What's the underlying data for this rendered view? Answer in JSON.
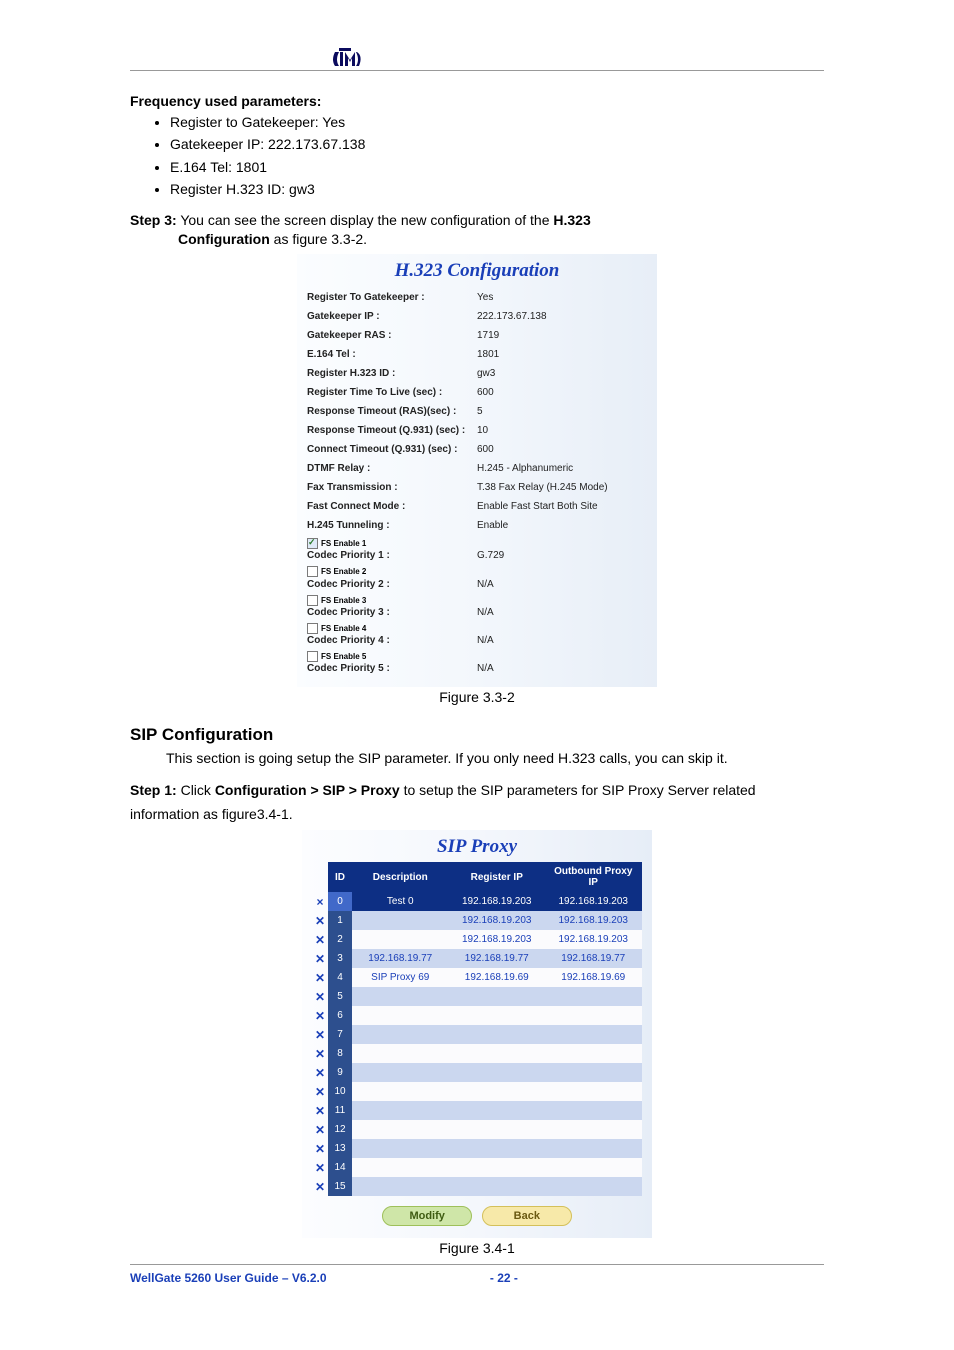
{
  "header": {
    "logo_text": "tm"
  },
  "freq": {
    "heading": "Frequency used parameters:",
    "items": [
      "Register to Gatekeeper: Yes",
      "Gatekeeper IP: 222.173.67.138",
      "E.164 Tel: 1801",
      "Register H.323 ID: gw3"
    ]
  },
  "step3": {
    "prefix": "Step 3:",
    "text1": " You can see the screen display the new configuration of the ",
    "bold1": "H.323",
    "text2": "Configuration",
    "text3": " as figure 3.3-2."
  },
  "h323": {
    "title": "H.323 Configuration",
    "rows": [
      {
        "label": "Register To Gatekeeper :",
        "value": "Yes"
      },
      {
        "label": "Gatekeeper IP :",
        "value": "222.173.67.138"
      },
      {
        "label": "Gatekeeper RAS :",
        "value": "1719"
      },
      {
        "label": "E.164 Tel :",
        "value": "1801"
      },
      {
        "label": "Register H.323 ID :",
        "value": "gw3"
      },
      {
        "label": "Register Time To Live (sec) :",
        "value": "600"
      },
      {
        "label": "Response Timeout (RAS)(sec) :",
        "value": "5"
      },
      {
        "label": "Response Timeout (Q.931) (sec) :",
        "value": "10"
      },
      {
        "label": "Connect Timeout (Q.931) (sec) :",
        "value": "600"
      },
      {
        "label": "DTMF Relay :",
        "value": "H.245 - Alphanumeric"
      },
      {
        "label": "Fax Transmission :",
        "value": "T.38 Fax Relay (H.245 Mode)"
      },
      {
        "label": "Fast Connect Mode :",
        "value": "Enable Fast Start Both Site"
      },
      {
        "label": "H.245 Tunneling :",
        "value": "Enable"
      }
    ],
    "codecs": [
      {
        "fs": "FS Enable 1",
        "label": "Codec Priority 1 :",
        "value": "G.729",
        "checked": true
      },
      {
        "fs": "FS Enable 2",
        "label": "Codec Priority 2 :",
        "value": "N/A",
        "checked": false
      },
      {
        "fs": "FS Enable 3",
        "label": "Codec Priority 3 :",
        "value": "N/A",
        "checked": false
      },
      {
        "fs": "FS Enable 4",
        "label": "Codec Priority 4 :",
        "value": "N/A",
        "checked": false
      },
      {
        "fs": "FS Enable 5",
        "label": "Codec Priority 5 :",
        "value": "N/A",
        "checked": false
      }
    ],
    "caption": "Figure 3.3-2"
  },
  "sipconf": {
    "heading": "SIP Configuration",
    "intro": "This section is going setup the SIP parameter. If you only need H.323 calls, you can skip it."
  },
  "step1": {
    "prefix": "Step 1:",
    "text1": " Click ",
    "bold1": "Configuration > SIP > Proxy",
    "text2": " to setup the SIP parameters for SIP Proxy Server related information as figure3.4-1."
  },
  "sipproxy": {
    "title": "SIP Proxy",
    "headers": {
      "id": "ID",
      "desc": "Description",
      "reg": "Register IP",
      "out": "Outbound Proxy IP"
    },
    "rows": [
      {
        "sel": true,
        "x": "×",
        "xc": "red",
        "id": "0",
        "desc": "Test 0",
        "reg": "192.168.19.203",
        "out": "192.168.19.203"
      },
      {
        "x": "✕",
        "xc": "muted",
        "id": "1",
        "desc": "",
        "reg": "192.168.19.203",
        "out": "192.168.19.203"
      },
      {
        "x": "✕",
        "xc": "muted",
        "id": "2",
        "desc": "",
        "reg": "192.168.19.203",
        "out": "192.168.19.203"
      },
      {
        "x": "✕",
        "xc": "muted",
        "id": "3",
        "desc": "192.168.19.77",
        "reg": "192.168.19.77",
        "out": "192.168.19.77"
      },
      {
        "x": "✕",
        "xc": "muted",
        "id": "4",
        "desc": "SIP Proxy 69",
        "reg": "192.168.19.69",
        "out": "192.168.19.69"
      },
      {
        "x": "✕",
        "xc": "muted",
        "id": "5",
        "desc": "",
        "reg": "",
        "out": ""
      },
      {
        "x": "✕",
        "xc": "muted",
        "id": "6",
        "desc": "",
        "reg": "",
        "out": ""
      },
      {
        "x": "✕",
        "xc": "muted",
        "id": "7",
        "desc": "",
        "reg": "",
        "out": ""
      },
      {
        "x": "✕",
        "xc": "muted",
        "id": "8",
        "desc": "",
        "reg": "",
        "out": ""
      },
      {
        "x": "✕",
        "xc": "muted",
        "id": "9",
        "desc": "",
        "reg": "",
        "out": ""
      },
      {
        "x": "✕",
        "xc": "muted",
        "id": "10",
        "desc": "",
        "reg": "",
        "out": ""
      },
      {
        "x": "✕",
        "xc": "muted",
        "id": "11",
        "desc": "",
        "reg": "",
        "out": ""
      },
      {
        "x": "✕",
        "xc": "muted",
        "id": "12",
        "desc": "",
        "reg": "",
        "out": ""
      },
      {
        "x": "✕",
        "xc": "muted",
        "id": "13",
        "desc": "",
        "reg": "",
        "out": ""
      },
      {
        "x": "✕",
        "xc": "muted",
        "id": "14",
        "desc": "",
        "reg": "",
        "out": ""
      },
      {
        "x": "✕",
        "xc": "muted",
        "id": "15",
        "desc": "",
        "reg": "",
        "out": ""
      }
    ],
    "modify": "Modify",
    "back": "Back",
    "caption": "Figure 3.4-1"
  },
  "footer": {
    "left": "WellGate 5260 User Guide – V6.2.0",
    "page": "- 22 -"
  }
}
